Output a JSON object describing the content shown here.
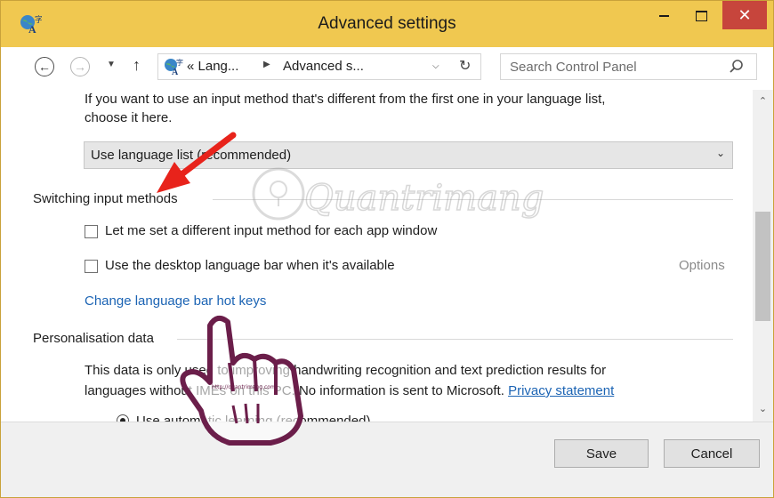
{
  "window": {
    "title": "Advanced settings"
  },
  "address": {
    "crumbs": [
      "« Lang...",
      "Advanced s..."
    ],
    "search_placeholder": "Search Control Panel"
  },
  "content": {
    "intro_line1": "If you want to use an input method that's different from the first one in your language list,",
    "intro_line2": "choose it here.",
    "override_select_value": "Use language list (recommended)",
    "switching": {
      "heading": "Switching input methods",
      "checkbox1_label": "Let me set a different input method for each app window",
      "checkbox2_label": "Use the desktop language bar when it's available",
      "options_link": "Options",
      "hotkeys_link": "Change language bar hot keys"
    },
    "personalisation": {
      "heading": "Personalisation data",
      "line1": "This data is only used to improving handwriting recognition and text prediction results for",
      "line2_prefix": "languages without IMEs on this PC. No information is sent to Microsoft.",
      "privacy_link": "Privacy statement",
      "radio1_label": "Use automatic learning (recommended)"
    }
  },
  "footer": {
    "save_label": "Save",
    "cancel_label": "Cancel"
  },
  "overlay": {
    "watermark_text": "Quantrimang",
    "url_text": "http://quantrimang.com"
  },
  "colors": {
    "titlebar": "#f0c850",
    "close_button": "#c7453c",
    "link": "#1c64b4",
    "arrow": "#e8231b",
    "hand": "#6b1e4a"
  }
}
